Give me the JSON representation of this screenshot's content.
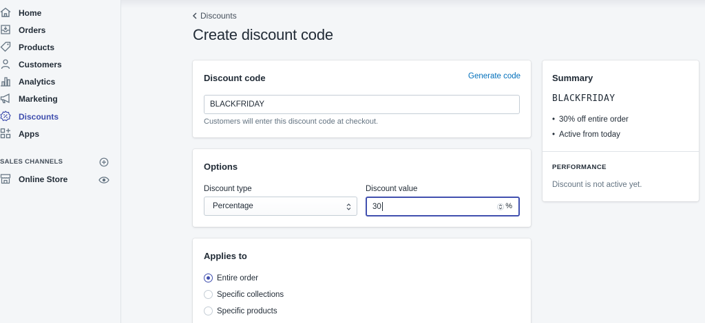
{
  "sidebar": {
    "items": [
      {
        "label": "Home",
        "icon": "home-icon"
      },
      {
        "label": "Orders",
        "icon": "orders-icon"
      },
      {
        "label": "Products",
        "icon": "tag-icon"
      },
      {
        "label": "Customers",
        "icon": "person-icon"
      },
      {
        "label": "Analytics",
        "icon": "bar-chart-icon"
      },
      {
        "label": "Marketing",
        "icon": "megaphone-icon"
      },
      {
        "label": "Discounts",
        "icon": "discount-icon",
        "active": true
      },
      {
        "label": "Apps",
        "icon": "apps-icon"
      }
    ],
    "sales_channels_label": "SALES CHANNELS",
    "channels": [
      {
        "label": "Online Store",
        "icon": "store-icon"
      }
    ]
  },
  "breadcrumb": {
    "label": "Discounts"
  },
  "page_title": "Create discount code",
  "discount_code_card": {
    "title": "Discount code",
    "generate_link": "Generate code",
    "code_value": "BLACKFRIDAY",
    "help_text": "Customers will enter this discount code at checkout."
  },
  "options_card": {
    "title": "Options",
    "type_label": "Discount type",
    "type_value": "Percentage",
    "value_label": "Discount value",
    "value": "30",
    "value_suffix": "%"
  },
  "applies_card": {
    "title": "Applies to",
    "options": [
      {
        "label": "Entire order",
        "checked": true
      },
      {
        "label": "Specific collections",
        "checked": false
      },
      {
        "label": "Specific products",
        "checked": false
      }
    ]
  },
  "summary_card": {
    "title": "Summary",
    "code": "BLACKFRIDAY",
    "details": [
      "30% off entire order",
      "Active from today"
    ],
    "performance_title": "PERFORMANCE",
    "performance_text": "Discount is not active yet."
  },
  "colors": {
    "accent": "#3f4eae",
    "link": "#006fbb",
    "background": "#f4f6f8",
    "text": "#212b36",
    "subdued": "#637381"
  }
}
